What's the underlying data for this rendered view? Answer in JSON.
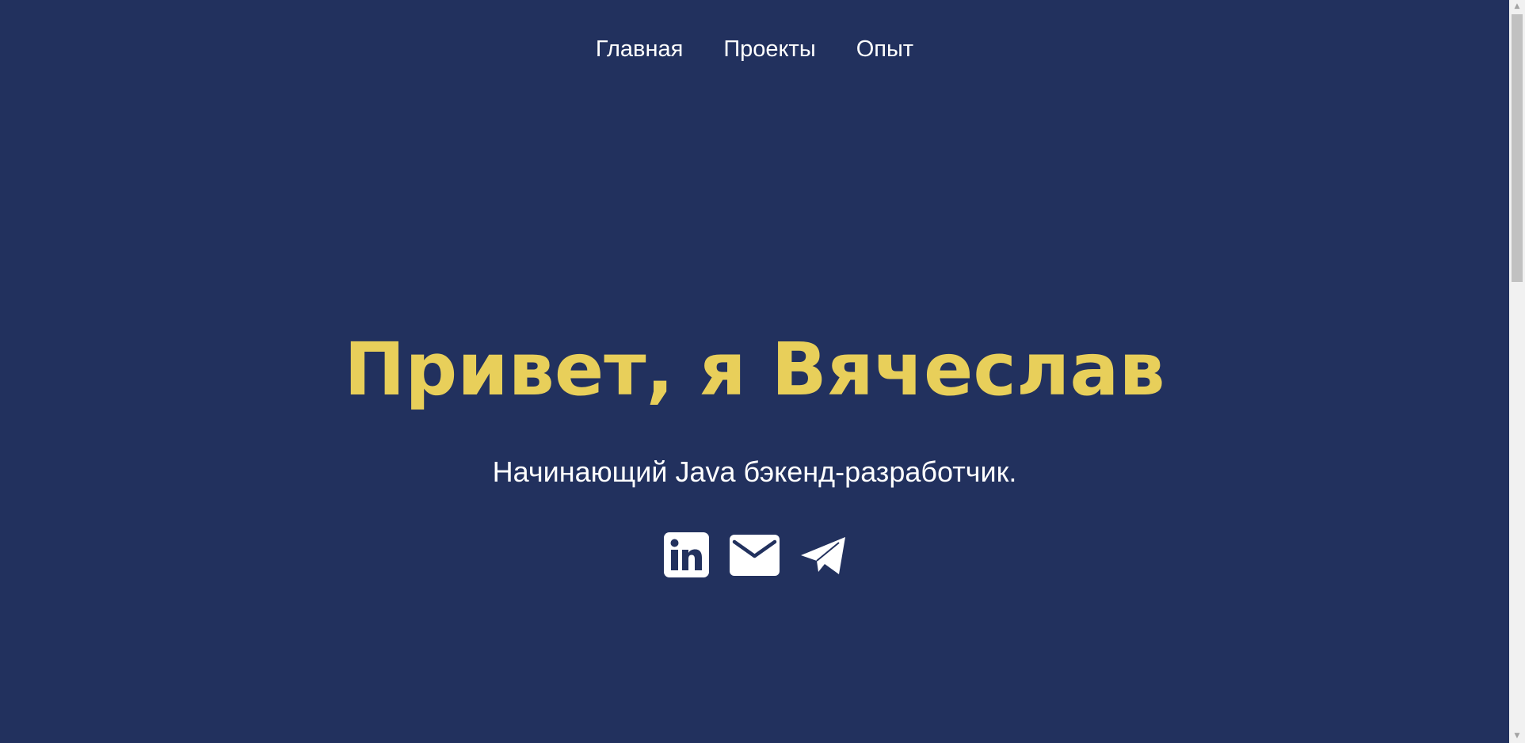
{
  "nav": {
    "items": [
      {
        "label": "Главная"
      },
      {
        "label": "Проекты"
      },
      {
        "label": "Опыт"
      }
    ]
  },
  "hero": {
    "title": "Привет, я Вячеслав",
    "subtitle": "Начинающий Java бэкенд-разработчик."
  },
  "socials": [
    {
      "icon": "linkedin-icon"
    },
    {
      "icon": "mail-icon"
    },
    {
      "icon": "telegram-icon"
    }
  ],
  "colors": {
    "background": "#22315e",
    "accent": "#e8cf5a",
    "text": "#ffffff"
  }
}
